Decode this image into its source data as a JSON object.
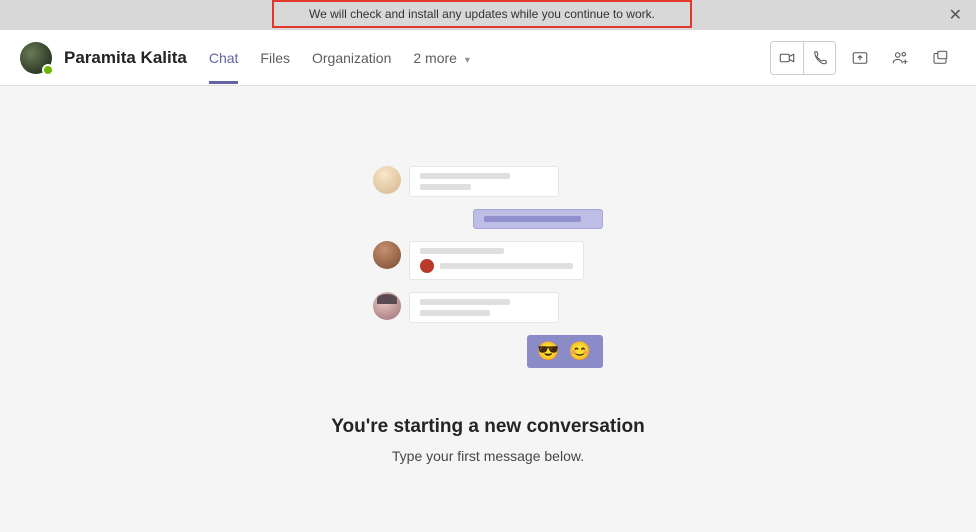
{
  "update_bar": {
    "message": "We will check and install any updates while you continue to work."
  },
  "header": {
    "contact_name": "Paramita Kalita",
    "tabs": {
      "chat": "Chat",
      "files": "Files",
      "org": "Organization",
      "more": "2 more"
    }
  },
  "empty_state": {
    "title": "You're starting a new conversation",
    "subtitle": "Type your first message below."
  },
  "emojis": "😎 😊"
}
